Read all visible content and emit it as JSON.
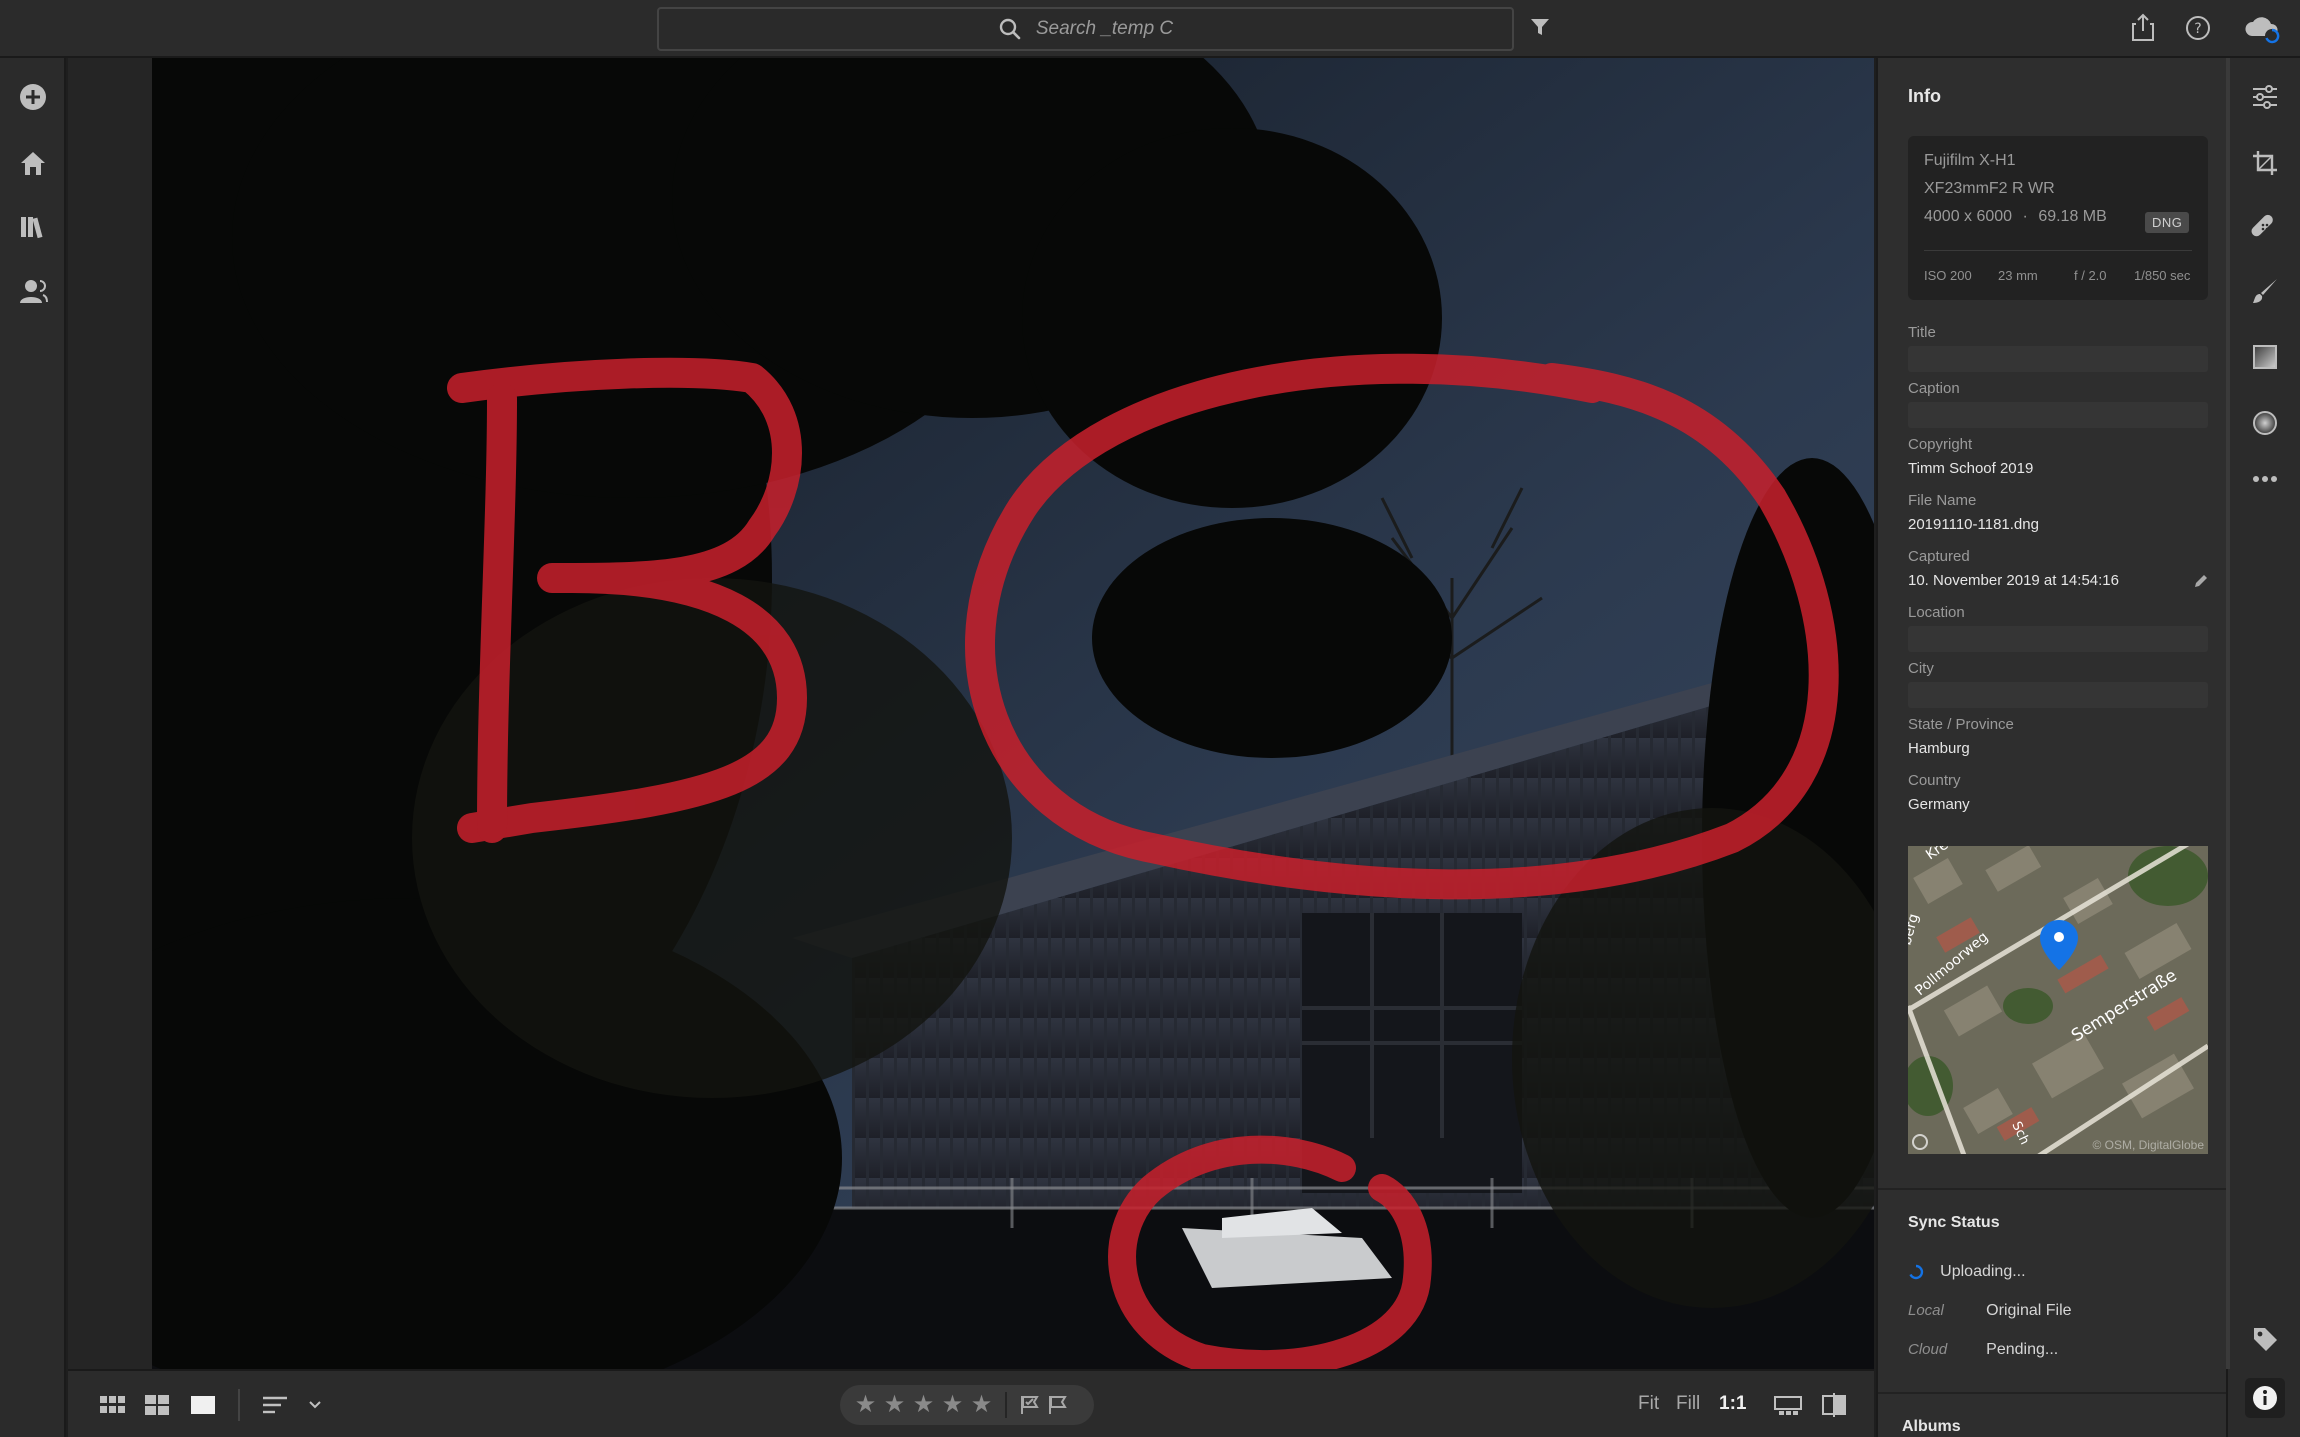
{
  "search": {
    "placeholder": "Search _temp C"
  },
  "panel": {
    "title": "Info",
    "camera": {
      "model": "Fujifilm X-H1",
      "lens": "XF23mmF2 R WR",
      "dimensions": "4000 x 6000",
      "file_size": "69.18 MB",
      "format_badge": "DNG",
      "iso": "ISO 200",
      "focal_length": "23 mm",
      "aperture": "f / 2.0",
      "shutter": "1/850 sec"
    },
    "fields": {
      "title_label": "Title",
      "caption_label": "Caption",
      "copyright_label": "Copyright",
      "copyright_value": "Timm Schoof 2019",
      "filename_label": "File Name",
      "filename_value": "20191110-1181.dng",
      "captured_label": "Captured",
      "captured_value": "10. November 2019 at 14:54:16",
      "location_label": "Location",
      "city_label": "City",
      "state_label": "State / Province",
      "state_value": "Hamburg",
      "country_label": "Country",
      "country_value": "Germany"
    },
    "map": {
      "street_1": "Semperstraße",
      "street_2": "Pollmoorweg",
      "street_3": "Kre",
      "street_4": "berg",
      "street_5": "Sch",
      "credit": "© OSM, DigitalGlobe"
    },
    "sync": {
      "title": "Sync Status",
      "status": "Uploading...",
      "local_label": "Local",
      "local_value": "Original File",
      "cloud_label": "Cloud",
      "cloud_value": "Pending..."
    },
    "albums_title": "Albums"
  },
  "bottombar": {
    "zoom_fit": "Fit",
    "zoom_fill": "Fill",
    "zoom_1to1": "1:1",
    "rating_stars": 0,
    "star_glyph": "★"
  },
  "photo": {
    "annotations": [
      "B",
      "O",
      "C"
    ]
  },
  "colors": {
    "accent_blue": "#1473e6",
    "annotation_red": "#e0202e",
    "panel_bg": "#2e2e2e",
    "chrome_bg": "#2b2b2b"
  }
}
